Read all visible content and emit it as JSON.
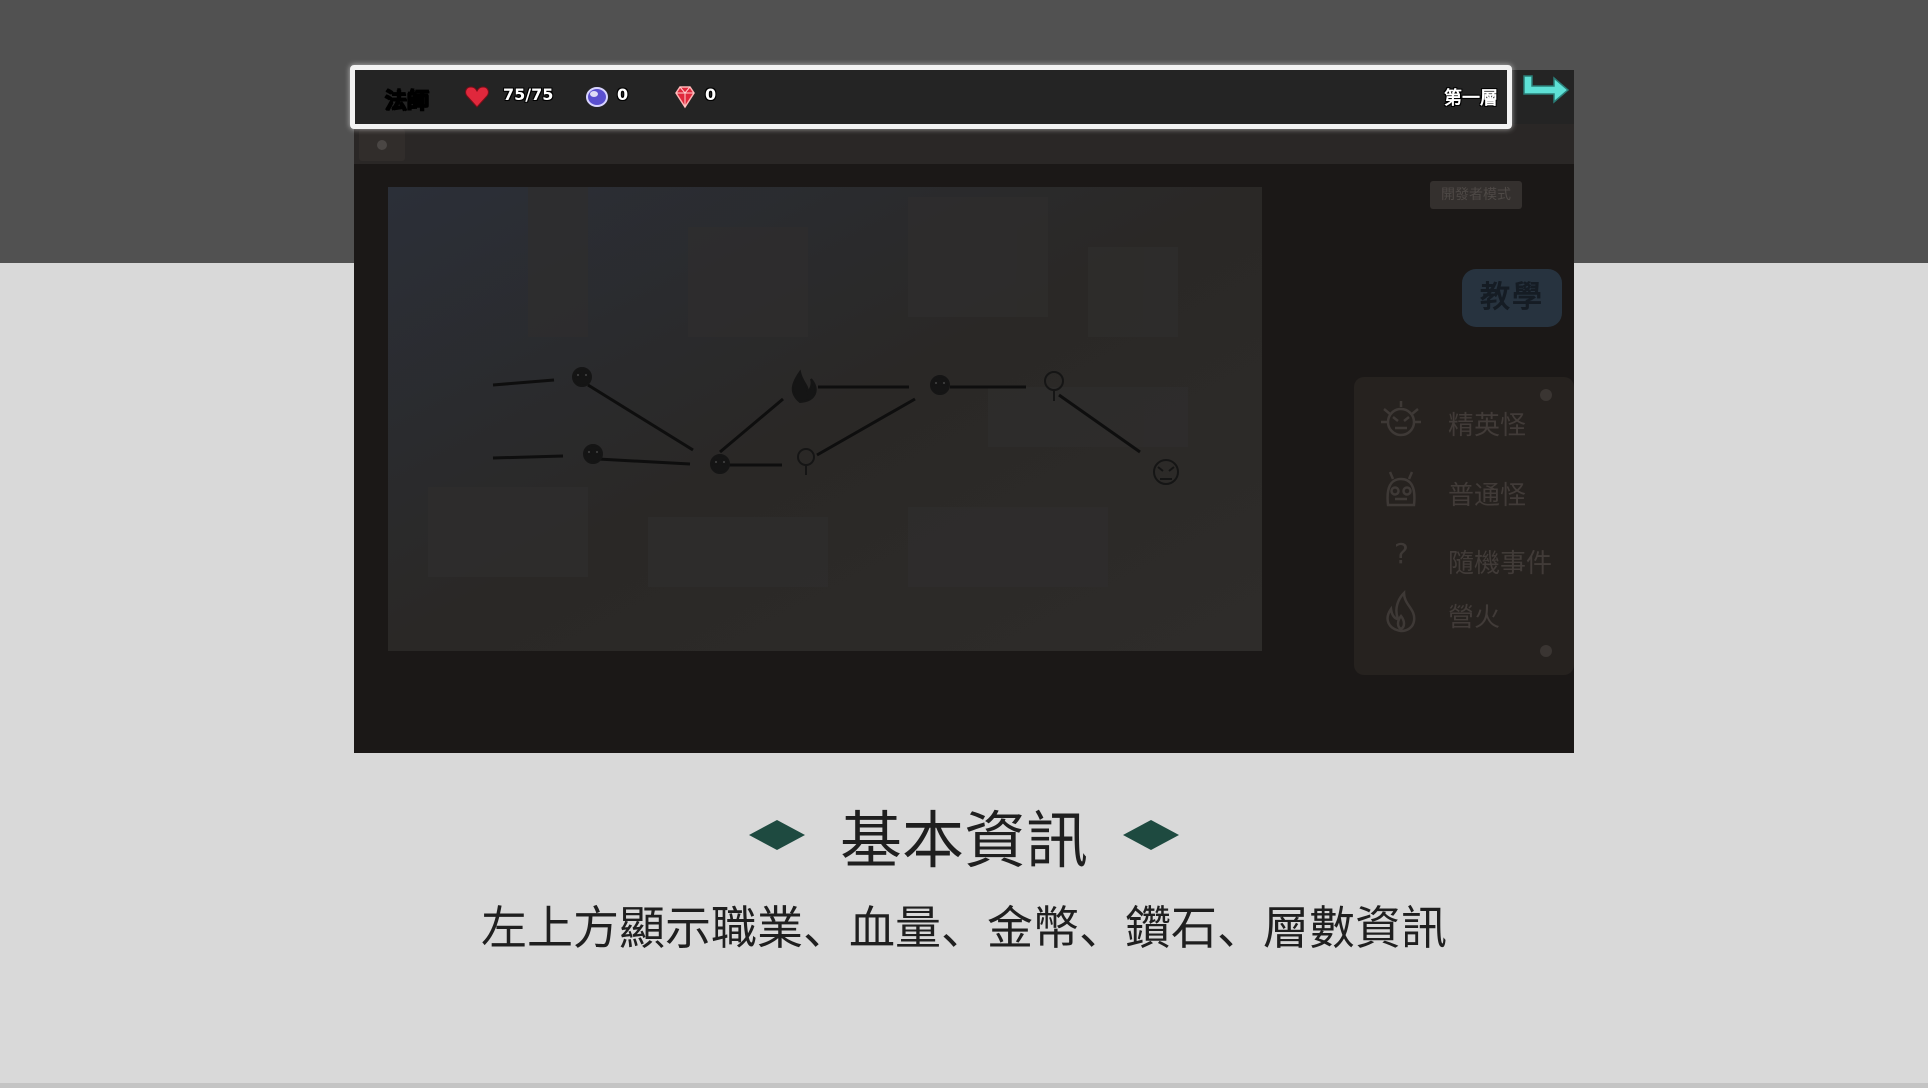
{
  "hud": {
    "class_name": "法師",
    "hp": "75/75",
    "coins": "0",
    "diamonds": "0",
    "floor": "第一層"
  },
  "toolbar": {
    "dev_mode_label": "開發者模式"
  },
  "tutorial": {
    "label": "教學"
  },
  "legend": {
    "items": [
      {
        "icon": "elite-monster-icon",
        "label": "精英怪"
      },
      {
        "icon": "normal-monster-icon",
        "label": "普通怪"
      },
      {
        "icon": "question-mark-icon",
        "label": "隨機事件"
      },
      {
        "icon": "campfire-icon",
        "label": "營火"
      }
    ]
  },
  "caption": {
    "title": "基本資訊",
    "subtitle": "左上方顯示職業、血量、金幣、鑽石、層數資訊"
  },
  "colors": {
    "accent_diamond": "#1e4a40",
    "highlight_border": "#f2f2f2",
    "exit_arrow": "#5ee0d6",
    "heart": "#e0283c"
  },
  "map": {
    "nodes": [
      {
        "id": "n1",
        "type": "normal"
      },
      {
        "id": "n2",
        "type": "normal"
      },
      {
        "id": "n3",
        "type": "normal"
      },
      {
        "id": "n4",
        "type": "campfire"
      },
      {
        "id": "n5",
        "type": "event"
      },
      {
        "id": "n6",
        "type": "normal"
      },
      {
        "id": "n7",
        "type": "event"
      },
      {
        "id": "n8",
        "type": "elite"
      }
    ]
  }
}
